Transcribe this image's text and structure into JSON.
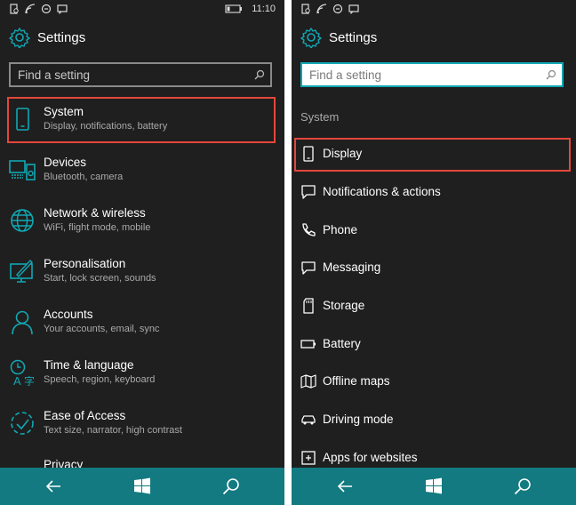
{
  "left": {
    "status": {
      "time": "11:10"
    },
    "header": {
      "title": "Settings"
    },
    "search": {
      "placeholder": "Find a setting"
    },
    "items": [
      {
        "label": "System",
        "sub": "Display, notifications, battery"
      },
      {
        "label": "Devices",
        "sub": "Bluetooth, camera"
      },
      {
        "label": "Network & wireless",
        "sub": "WiFi, flight mode, mobile"
      },
      {
        "label": "Personalisation",
        "sub": "Start, lock screen, sounds"
      },
      {
        "label": "Accounts",
        "sub": "Your accounts, email, sync"
      },
      {
        "label": "Time & language",
        "sub": "Speech, region, keyboard"
      },
      {
        "label": "Ease of Access",
        "sub": "Text size, narrator, high contrast"
      },
      {
        "label": "Privacy",
        "sub": ""
      }
    ]
  },
  "right": {
    "header": {
      "title": "Settings"
    },
    "search": {
      "placeholder": "Find a setting"
    },
    "section": "System",
    "items": [
      {
        "label": "Display"
      },
      {
        "label": "Notifications & actions"
      },
      {
        "label": "Phone"
      },
      {
        "label": "Messaging"
      },
      {
        "label": "Storage"
      },
      {
        "label": "Battery"
      },
      {
        "label": "Offline maps"
      },
      {
        "label": "Driving mode"
      },
      {
        "label": "Apps for websites"
      }
    ]
  },
  "colors": {
    "accent": "#10a8b4",
    "highlight": "#e4473b",
    "navbar": "#127a80",
    "background": "#1f1f1f"
  }
}
